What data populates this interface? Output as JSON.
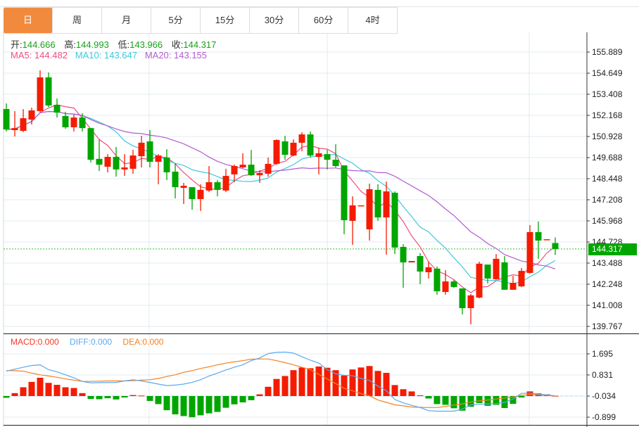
{
  "tabs": [
    {
      "label": "日",
      "active": true
    },
    {
      "label": "周"
    },
    {
      "label": "月"
    },
    {
      "label": "5分"
    },
    {
      "label": "15分"
    },
    {
      "label": "30分"
    },
    {
      "label": "60分"
    },
    {
      "label": "4时"
    }
  ],
  "ohlc_info": {
    "open_label": "开:",
    "open": "144.666",
    "high_label": "高:",
    "high": "144.993",
    "low_label": "低:",
    "low": "143.966",
    "close_label": "收:",
    "close": "144.317"
  },
  "ma_info": {
    "ma5": "MA5: 144.482",
    "ma10": "MA10: 143.647",
    "ma20": "MA20: 143.155"
  },
  "macd_info": {
    "macd": "MACD:0.000",
    "diff": "DIFF:0.000",
    "dea": "DEA:0.000"
  },
  "last_price": "144.317",
  "colors": {
    "up": "#f51b00",
    "down": "#00a600",
    "tab_active": "#f28a3e",
    "ma5": "#ee4f7e",
    "ma10": "#3ec8de",
    "ma20": "#b25cd0",
    "diff": "#5aa8ef",
    "dea": "#f58220"
  },
  "chart_data": [
    {
      "type": "candlestick",
      "title": "Daily K-line",
      "y_ticks": [
        "155.889",
        "154.649",
        "153.408",
        "152.168",
        "150.928",
        "149.688",
        "148.448",
        "147.208",
        "145.968",
        "144.728",
        "143.488",
        "142.248",
        "141.008",
        "139.767"
      ],
      "ylim": [
        139.767,
        155.889
      ],
      "ohlc": [
        [
          152.54,
          152.87,
          151.22,
          151.34
        ],
        [
          151.3,
          152.42,
          150.93,
          151.42
        ],
        [
          151.26,
          152.54,
          151.18,
          152.0
        ],
        [
          151.92,
          152.62,
          151.63,
          152.46
        ],
        [
          152.42,
          154.81,
          152.33,
          154.4
        ],
        [
          154.4,
          154.69,
          152.66,
          152.75
        ],
        [
          152.79,
          153.16,
          152.04,
          152.33
        ],
        [
          152.13,
          152.38,
          151.38,
          151.47
        ],
        [
          151.47,
          152.21,
          151.22,
          152.04
        ],
        [
          152.04,
          152.29,
          151.22,
          151.42
        ],
        [
          151.42,
          151.42,
          149.4,
          149.56
        ],
        [
          149.61,
          150.76,
          148.9,
          149.27
        ],
        [
          149.15,
          149.89,
          148.82,
          149.73
        ],
        [
          149.73,
          150.31,
          148.57,
          148.99
        ],
        [
          148.99,
          149.89,
          148.61,
          149.11
        ],
        [
          149.03,
          150.14,
          148.74,
          149.81
        ],
        [
          149.77,
          150.97,
          149.11,
          150.56
        ],
        [
          150.64,
          151.3,
          149.11,
          149.44
        ],
        [
          149.44,
          149.89,
          148.12,
          149.81
        ],
        [
          149.69,
          150.18,
          148.37,
          148.82
        ],
        [
          148.86,
          149.36,
          147.29,
          147.95
        ],
        [
          147.91,
          148.2,
          146.96,
          148.03
        ],
        [
          147.95,
          147.95,
          146.63,
          147.25
        ],
        [
          147.25,
          148.12,
          146.55,
          147.79
        ],
        [
          147.75,
          149.19,
          147.66,
          148.24
        ],
        [
          148.24,
          148.37,
          147.41,
          147.79
        ],
        [
          147.75,
          149.03,
          147.66,
          148.61
        ],
        [
          148.7,
          149.27,
          148.24,
          149.19
        ],
        [
          149.11,
          149.94,
          149.07,
          149.27
        ],
        [
          149.27,
          150.14,
          148.61,
          148.65
        ],
        [
          148.65,
          148.94,
          148.2,
          148.78
        ],
        [
          148.74,
          149.69,
          148.57,
          149.32
        ],
        [
          149.32,
          150.76,
          149.27,
          150.72
        ],
        [
          150.64,
          150.97,
          149.56,
          149.85
        ],
        [
          149.81,
          150.76,
          149.77,
          150.56
        ],
        [
          150.56,
          151.18,
          150.06,
          151.05
        ],
        [
          151.05,
          151.22,
          149.69,
          149.81
        ],
        [
          149.73,
          150.27,
          148.7,
          149.94
        ],
        [
          149.89,
          150.14,
          148.99,
          149.56
        ],
        [
          149.56,
          150.47,
          149.11,
          149.19
        ],
        [
          149.23,
          149.23,
          145.18,
          146.01
        ],
        [
          145.97,
          147.41,
          144.56,
          146.88
        ],
        [
          146.84,
          146.88,
          146.84,
          146.88
        ],
        [
          145.47,
          148.16,
          144.81,
          147.83
        ],
        [
          147.79,
          148.12,
          145.97,
          146.17
        ],
        [
          146.17,
          148.28,
          143.98,
          147.7
        ],
        [
          147.62,
          147.7,
          144.02,
          144.4
        ],
        [
          144.44,
          144.6,
          142.04,
          143.53
        ],
        [
          143.53,
          143.61,
          143.53,
          143.61
        ],
        [
          143.9,
          144.07,
          142.25,
          142.99
        ],
        [
          142.95,
          143.57,
          142.58,
          143.24
        ],
        [
          143.16,
          143.28,
          141.63,
          141.83
        ],
        [
          141.79,
          143.07,
          141.63,
          142.41
        ],
        [
          142.41,
          142.5,
          142.04,
          142.08
        ],
        [
          142.0,
          142.0,
          140.47,
          140.84
        ],
        [
          140.84,
          141.67,
          139.89,
          141.59
        ],
        [
          141.46,
          143.57,
          141.42,
          143.45
        ],
        [
          143.4,
          143.4,
          142.29,
          142.58
        ],
        [
          142.54,
          144.02,
          142.5,
          143.74
        ],
        [
          143.53,
          143.9,
          141.92,
          141.92
        ],
        [
          141.92,
          142.74,
          141.92,
          142.33
        ],
        [
          142.12,
          143.2,
          142.08,
          143.03
        ],
        [
          142.91,
          145.72,
          142.87,
          145.31
        ],
        [
          145.31,
          145.93,
          143.74,
          144.81
        ],
        [
          144.85,
          144.89,
          144.85,
          144.89
        ],
        [
          144.666,
          144.993,
          143.966,
          144.317
        ]
      ],
      "ma_periods": [
        5,
        10,
        20
      ]
    },
    {
      "type": "bar+line",
      "title": "MACD",
      "y_ticks": [
        "1.695",
        "0.831",
        "-0.034",
        "-0.899"
      ],
      "histogram": [
        -0.07,
        0.12,
        0.36,
        0.58,
        0.75,
        0.54,
        0.46,
        0.36,
        0.33,
        0.12,
        -0.12,
        -0.13,
        -0.09,
        -0.14,
        -0.06,
        0.04,
        0.02,
        -0.2,
        -0.33,
        -0.58,
        -0.75,
        -0.82,
        -0.87,
        -0.79,
        -0.71,
        -0.65,
        -0.48,
        -0.34,
        -0.26,
        -0.17,
        0.07,
        0.38,
        0.7,
        0.82,
        1.06,
        1.17,
        1.14,
        1.21,
        1.16,
        1.06,
        0.84,
        1.09,
        1.17,
        1.23,
        1.03,
        0.95,
        0.45,
        0.28,
        0.19,
        0.03,
        -0.1,
        -0.33,
        -0.36,
        -0.5,
        -0.6,
        -0.44,
        -0.29,
        -0.4,
        -0.36,
        -0.49,
        -0.32,
        -0.06,
        0.19,
        0.11,
        0.07,
        0.01
      ],
      "diff": [
        1.02,
        1.1,
        1.18,
        1.25,
        1.28,
        1.08,
        0.99,
        0.87,
        0.75,
        0.6,
        0.54,
        0.55,
        0.55,
        0.56,
        0.62,
        0.67,
        0.62,
        0.56,
        0.49,
        0.43,
        0.45,
        0.49,
        0.56,
        0.67,
        0.82,
        0.94,
        1.07,
        1.18,
        1.28,
        1.45,
        1.56,
        1.74,
        1.79,
        1.8,
        1.76,
        1.61,
        1.47,
        1.35,
        1.08,
        0.91,
        0.85,
        0.83,
        0.72,
        0.64,
        0.41,
        0.22,
        -0.14,
        -0.28,
        -0.38,
        -0.47,
        -0.6,
        -0.62,
        -0.62,
        -0.62,
        -0.53,
        -0.36,
        -0.34,
        -0.32,
        -0.31,
        -0.26,
        -0.12,
        0.11,
        0.12,
        0.08,
        0.05,
        0.01
      ],
      "dea": [
        1.04,
        1.04,
        1.02,
        0.94,
        0.87,
        0.82,
        0.77,
        0.7,
        0.65,
        0.6,
        0.6,
        0.61,
        0.62,
        0.62,
        0.62,
        0.63,
        0.65,
        0.67,
        0.72,
        0.8,
        0.87,
        0.97,
        1.04,
        1.13,
        1.2,
        1.28,
        1.35,
        1.4,
        1.45,
        1.51,
        1.52,
        1.52,
        1.45,
        1.37,
        1.28,
        1.18,
        1.08,
        0.89,
        0.7,
        0.51,
        0.32,
        0.22,
        0.1,
        0.01,
        -0.16,
        -0.26,
        -0.36,
        -0.4,
        -0.45,
        -0.46,
        -0.47,
        -0.47,
        -0.43,
        -0.37,
        -0.32,
        -0.24,
        -0.2,
        -0.16,
        -0.12,
        -0.08,
        -0.04,
        0.03,
        0.06,
        0.05,
        0.03,
        0.0
      ]
    }
  ]
}
